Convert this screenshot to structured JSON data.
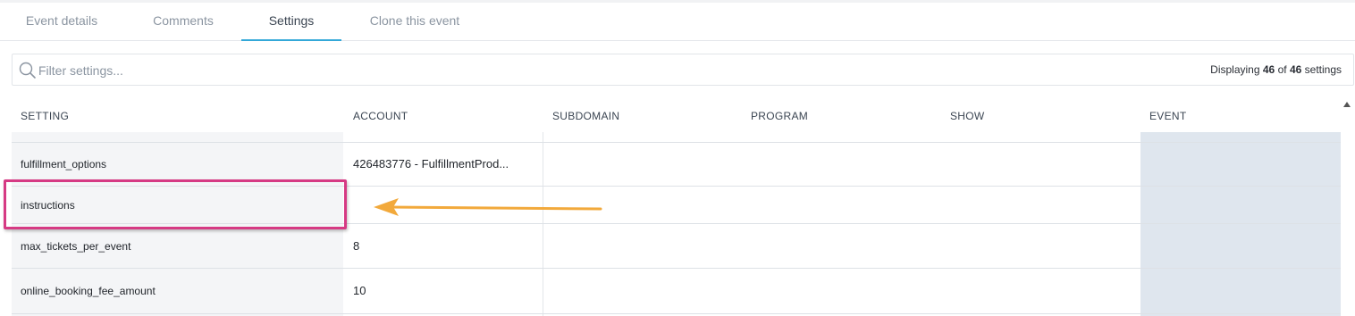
{
  "tabs": [
    {
      "label": "Event details",
      "active": false
    },
    {
      "label": "Comments",
      "active": false
    },
    {
      "label": "Settings",
      "active": true
    },
    {
      "label": "Clone this event",
      "active": false
    }
  ],
  "filter": {
    "placeholder": "Filter settings...",
    "value": "",
    "count_prefix": "Displaying",
    "shown": "46",
    "of": "of",
    "total": "46",
    "count_suffix": "settings"
  },
  "table": {
    "columns": [
      "SETTING",
      "ACCOUNT",
      "SUBDOMAIN",
      "PROGRAM",
      "SHOW",
      "EVENT"
    ],
    "rows": [
      {
        "setting": "fulfillment_options",
        "account": "426483776 - FulfillmentProd..."
      },
      {
        "setting": "instructions",
        "account": ""
      },
      {
        "setting": "max_tickets_per_event",
        "account": "8"
      },
      {
        "setting": "online_booking_fee_amount",
        "account": "10"
      }
    ]
  },
  "colors": {
    "accent": "#33a8d8",
    "highlight_box": "#d63a84",
    "arrow": "#f2a93b",
    "event_column": "#dfe6ee"
  },
  "icons": [
    "search-icon",
    "scroll-up-icon",
    "annotation-arrow"
  ]
}
